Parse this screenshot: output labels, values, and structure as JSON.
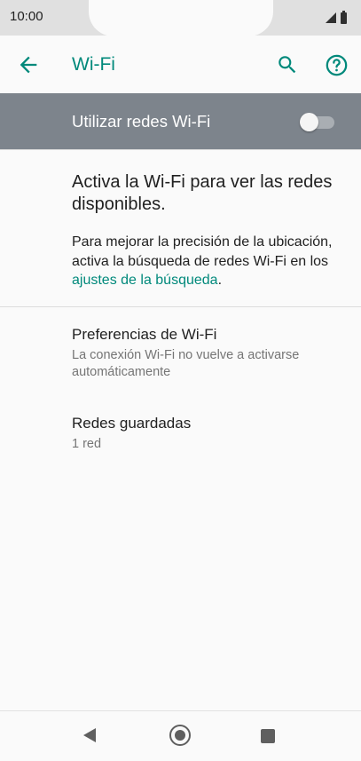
{
  "status_bar": {
    "time": "10:00",
    "icons": [
      "signal-icon",
      "battery-icon"
    ]
  },
  "app_bar": {
    "title": "Wi-Fi",
    "actions": [
      "back-icon",
      "search-icon",
      "help-icon"
    ],
    "accent_color": "#00897b"
  },
  "master_switch": {
    "label": "Utilizar redes Wi-Fi",
    "enabled": false,
    "background_color": "#7d848c"
  },
  "info": {
    "title": "Activa la Wi-Fi para ver las redes disponibles.",
    "body_prefix": "Para mejorar la precisión de la ubi­cación, activa la búsqueda de redes Wi-Fi en los ",
    "link_text": "ajustes de la búsqueda",
    "body_suffix": "."
  },
  "preferences": [
    {
      "title": "Preferencias de Wi-Fi",
      "summary": "La conexión Wi-Fi no vuelve a activarse automáticamente"
    },
    {
      "title": "Redes guardadas",
      "summary": "1 red"
    }
  ],
  "nav_bar": {
    "buttons": [
      "nav-back-icon",
      "nav-home-icon",
      "nav-recents-icon"
    ]
  }
}
